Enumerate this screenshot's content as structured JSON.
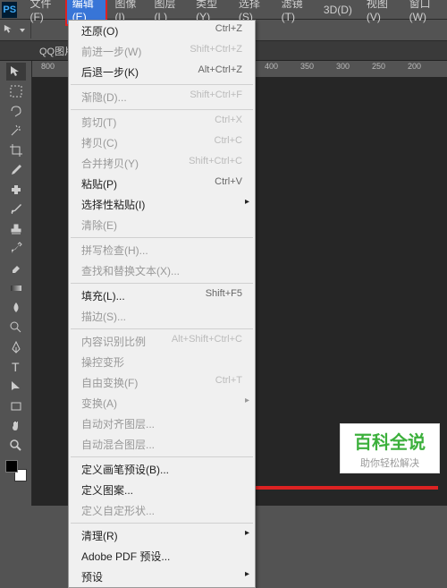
{
  "menubar": {
    "logo": "PS",
    "items": [
      {
        "label": "文件(F)"
      },
      {
        "label": "编辑(E)",
        "active": true
      },
      {
        "label": "图像(I)"
      },
      {
        "label": "图层(L)"
      },
      {
        "label": "类型(Y)"
      },
      {
        "label": "选择(S)"
      },
      {
        "label": "滤镜(T)"
      },
      {
        "label": "3D(D)"
      },
      {
        "label": "视图(V)"
      },
      {
        "label": "窗口(W)"
      }
    ]
  },
  "tabs": {
    "visible": "QQ图片"
  },
  "ruler": {
    "marks": [
      "800",
      "400",
      "350",
      "300",
      "250",
      "200"
    ]
  },
  "dropdown": {
    "items": [
      {
        "label": "还原(O)",
        "shortcut": "Ctrl+Z"
      },
      {
        "label": "前进一步(W)",
        "shortcut": "Shift+Ctrl+Z",
        "disabled": true
      },
      {
        "label": "后退一步(K)",
        "shortcut": "Alt+Ctrl+Z"
      },
      {
        "sep": true
      },
      {
        "label": "渐隐(D)...",
        "shortcut": "Shift+Ctrl+F",
        "disabled": true
      },
      {
        "sep": true
      },
      {
        "label": "剪切(T)",
        "shortcut": "Ctrl+X",
        "disabled": true
      },
      {
        "label": "拷贝(C)",
        "shortcut": "Ctrl+C",
        "disabled": true
      },
      {
        "label": "合并拷贝(Y)",
        "shortcut": "Shift+Ctrl+C",
        "disabled": true
      },
      {
        "label": "粘贴(P)",
        "shortcut": "Ctrl+V"
      },
      {
        "label": "选择性粘贴(I)",
        "submenu": true
      },
      {
        "label": "清除(E)",
        "disabled": true
      },
      {
        "sep": true
      },
      {
        "label": "拼写检查(H)...",
        "disabled": true
      },
      {
        "label": "查找和替换文本(X)...",
        "disabled": true
      },
      {
        "sep": true
      },
      {
        "label": "填充(L)...",
        "shortcut": "Shift+F5"
      },
      {
        "label": "描边(S)...",
        "disabled": true
      },
      {
        "sep": true
      },
      {
        "label": "内容识别比例",
        "shortcut": "Alt+Shift+Ctrl+C",
        "disabled": true
      },
      {
        "label": "操控变形",
        "disabled": true
      },
      {
        "label": "自由变换(F)",
        "shortcut": "Ctrl+T",
        "disabled": true
      },
      {
        "label": "变换(A)",
        "submenu": true,
        "disabled": true
      },
      {
        "label": "自动对齐图层...",
        "disabled": true
      },
      {
        "label": "自动混合图层...",
        "disabled": true
      },
      {
        "sep": true
      },
      {
        "label": "定义画笔预设(B)..."
      },
      {
        "label": "定义图案..."
      },
      {
        "label": "定义自定形状...",
        "disabled": true
      },
      {
        "sep": true
      },
      {
        "label": "清理(R)",
        "submenu": true
      },
      {
        "label": "Adobe PDF 预设..."
      },
      {
        "label": "预设",
        "submenu": true
      }
    ]
  },
  "watermark": {
    "title": "百科全说",
    "sub": "助你轻松解决"
  },
  "tools": [
    "move",
    "marquee",
    "lasso",
    "wand",
    "crop",
    "eyedropper",
    "heal",
    "brush",
    "stamp",
    "history",
    "eraser",
    "gradient",
    "blur",
    "dodge",
    "pen",
    "type",
    "path",
    "rectangle",
    "hand",
    "zoom"
  ]
}
